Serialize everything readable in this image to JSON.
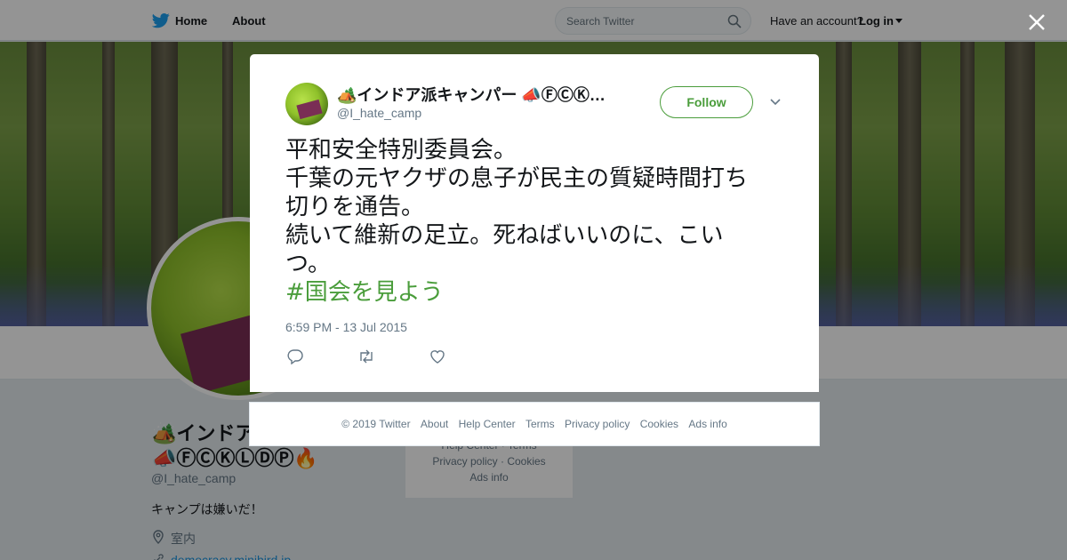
{
  "nav": {
    "home": "Home",
    "about": "About",
    "search_placeholder": "Search Twitter",
    "have_account": "Have an account?",
    "login": "Log in"
  },
  "profile": {
    "name_line1": "🏕️インドア",
    "name_line2": "📣ⒻⒸⓀⓁⒹⓅ🔥",
    "handle": "@I_hate_camp",
    "bio": "キャンプは嫌いだ！",
    "location": "室内",
    "url": "democracy.minibird.jp"
  },
  "side_card": {
    "line1": "Help Center · Terms",
    "line2": "Privacy policy · Cookies",
    "line3": "Ads info"
  },
  "tweet": {
    "name": "🏕️インドア派キャンパー 📣ⒻⒸⓀ…",
    "handle": "@I_hate_camp",
    "follow_label": "Follow",
    "lines": [
      "平和安全特別委員会。",
      "千葉の元ヤクザの息子が民主の質疑時間打ち",
      "切りを通告。",
      "続いて維新の足立。死ねばいいのに、こい",
      "つ。"
    ],
    "hashtag": "#国会を見よう",
    "timestamp": "6:59 PM - 13 Jul 2015"
  },
  "footer": {
    "copyright": "© 2019 Twitter",
    "about": "About",
    "help": "Help Center",
    "terms": "Terms",
    "privacy": "Privacy policy",
    "cookies": "Cookies",
    "ads": "Ads info"
  },
  "colors": {
    "accent_green": "#4a9d3b",
    "text": "#14171a",
    "muted": "#657786"
  }
}
